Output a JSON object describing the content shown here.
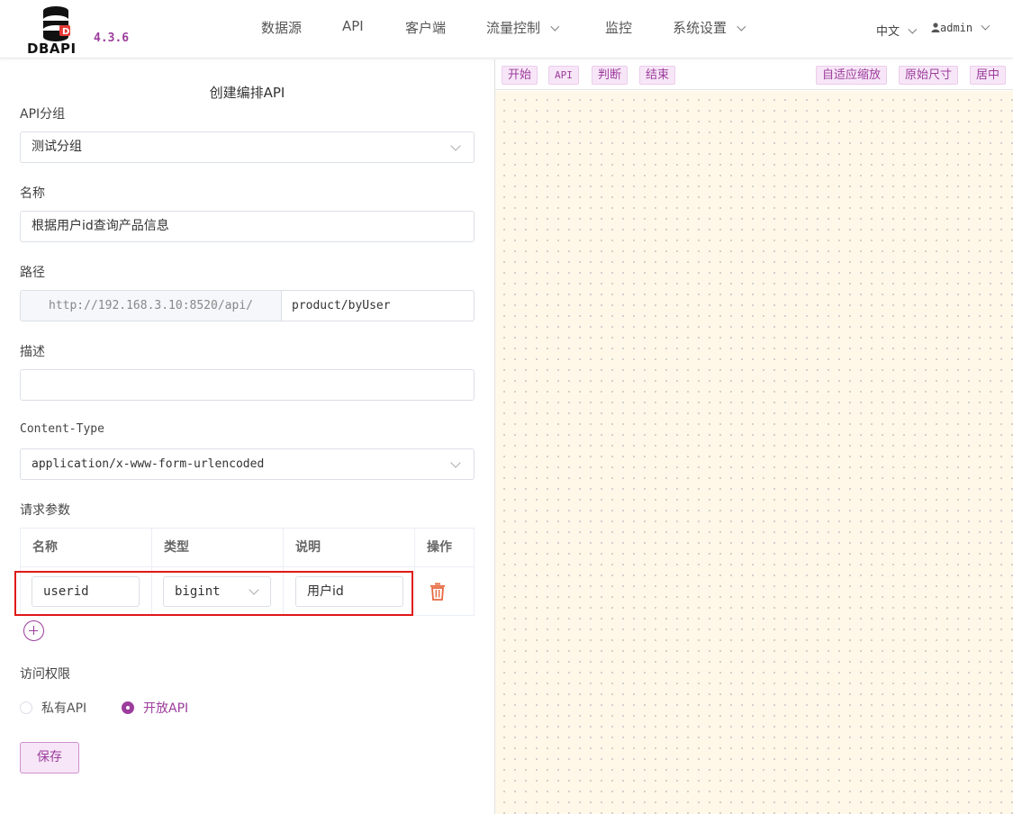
{
  "app": {
    "logo_text": "DBAPI",
    "version": "4.3.6",
    "brand_color": "#9c3d9c"
  },
  "nav": {
    "items": [
      {
        "label": "数据源",
        "dropdown": false
      },
      {
        "label": "API",
        "dropdown": false
      },
      {
        "label": "客户端",
        "dropdown": false
      },
      {
        "label": "流量控制",
        "dropdown": true
      },
      {
        "label": "监控",
        "dropdown": false
      },
      {
        "label": "系统设置",
        "dropdown": true
      }
    ],
    "language": "中文",
    "user": "admin"
  },
  "form": {
    "title": "创建编排API",
    "group_label": "API分组",
    "group_value": "测试分组",
    "name_label": "名称",
    "name_value": "根据用户id查询产品信息",
    "path_label": "路径",
    "path_prefix": "http://192.168.3.10:8520/api/",
    "path_value": "product/byUser",
    "desc_label": "描述",
    "desc_value": "",
    "content_type_label": "Content-Type",
    "content_type_value": "application/x-www-form-urlencoded",
    "params_label": "请求参数",
    "params_table": {
      "headers": [
        "名称",
        "类型",
        "说明",
        "操作"
      ],
      "rows": [
        {
          "name": "userid",
          "type": "bigint",
          "note": "用户id"
        }
      ]
    },
    "access_label": "访问权限",
    "access_options": [
      {
        "label": "私有API",
        "selected": false
      },
      {
        "label": "开放API",
        "selected": true
      }
    ],
    "save_label": "保存"
  },
  "canvas_toolbar": {
    "left": [
      "开始",
      "API",
      "判断",
      "结束"
    ],
    "right": [
      "自适应缩放",
      "原始尺寸",
      "居中"
    ]
  }
}
